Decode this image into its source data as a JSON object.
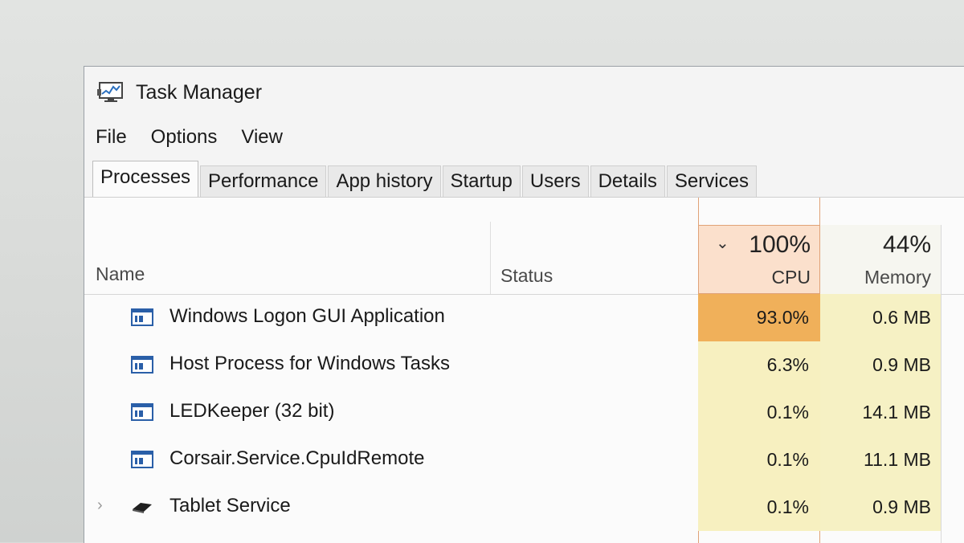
{
  "window": {
    "title": "Task Manager"
  },
  "menu": [
    "File",
    "Options",
    "View"
  ],
  "tabs": [
    {
      "label": "Processes",
      "active": true
    },
    {
      "label": "Performance",
      "active": false
    },
    {
      "label": "App history",
      "active": false
    },
    {
      "label": "Startup",
      "active": false
    },
    {
      "label": "Users",
      "active": false
    },
    {
      "label": "Details",
      "active": false
    },
    {
      "label": "Services",
      "active": false
    }
  ],
  "columns": {
    "name": "Name",
    "status": "Status",
    "cpu_total": "100%",
    "cpu_label": "CPU",
    "memory_total": "44%",
    "memory_label": "Memory"
  },
  "processes": [
    {
      "name": "Windows Logon GUI Application",
      "cpu": "93.0%",
      "memory": "0.6 MB",
      "icon": "window-app-icon",
      "expandable": false,
      "cpu_heat": "#f0b05a"
    },
    {
      "name": "Host Process for Windows Tasks",
      "cpu": "6.3%",
      "memory": "0.9 MB",
      "icon": "window-app-icon",
      "expandable": false,
      "cpu_heat": "#f7f0c0"
    },
    {
      "name": "LEDKeeper (32 bit)",
      "cpu": "0.1%",
      "memory": "14.1 MB",
      "icon": "window-app-icon",
      "expandable": false,
      "cpu_heat": "#f7f0c0"
    },
    {
      "name": "Corsair.Service.CpuIdRemote",
      "cpu": "0.1%",
      "memory": "11.1 MB",
      "icon": "window-app-icon",
      "expandable": false,
      "cpu_heat": "#f7f0c0"
    },
    {
      "name": "Tablet Service",
      "cpu": "0.1%",
      "memory": "0.9 MB",
      "icon": "tablet-pen-icon",
      "expandable": true,
      "cpu_heat": "#f7f0c0"
    }
  ],
  "colors": {
    "memory_cell": "#f6f1c4",
    "cpu_header": "#fbe0cc",
    "cpu_border": "#e0a277"
  }
}
